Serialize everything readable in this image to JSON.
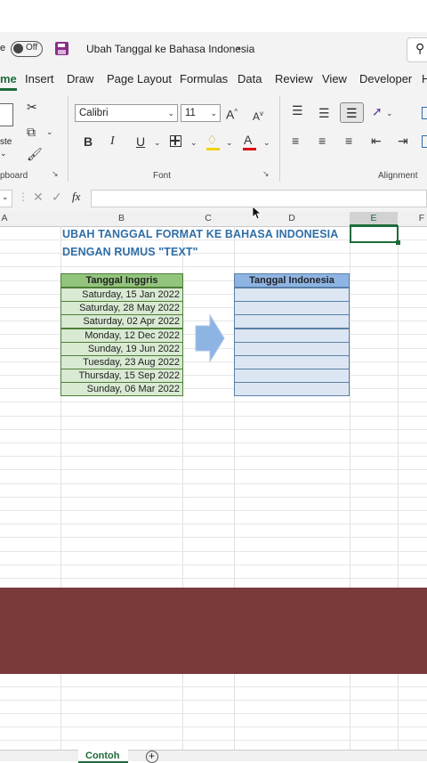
{
  "titlebar": {
    "autosave_suffix": "e",
    "autosave_state": "Off",
    "doc_title": "Ubah Tanggal ke Bahasa Indonesia",
    "search_glyph": "⚲"
  },
  "tabs": [
    "me",
    "Insert",
    "Draw",
    "Page Layout",
    "Formulas",
    "Data",
    "Review",
    "View",
    "Developer",
    "H"
  ],
  "ribbon": {
    "font_name": "Calibri",
    "font_size": "11",
    "paste_label": "ste",
    "clipboard_label": "pboard",
    "font_label": "Font",
    "alignment_label": "Alignment"
  },
  "formula_bar": {
    "fx": "fx",
    "value": ""
  },
  "columns": [
    "A",
    "B",
    "C",
    "D",
    "E",
    "F"
  ],
  "sheet": {
    "heading_line1": "UBAH TANGGAL FORMAT KE BAHASA INDONESIA",
    "heading_line2": "DENGAN RUMUS \"TEXT\"",
    "left_header": "Tanggal Inggris",
    "right_header": "Tanggal Indonesia",
    "dates": [
      "Saturday, 15 Jan 2022",
      "Saturday, 28 May 2022",
      "Saturday, 02 Apr 2022",
      "Monday, 12 Dec 2022",
      "Sunday, 19 Jun 2022",
      "Tuesday, 23 Aug 2022",
      "Thursday, 15 Sep 2022",
      "Sunday, 06 Mar 2022"
    ]
  },
  "sheet_tabs": {
    "active": "Contoh",
    "add": "+"
  },
  "colors": {
    "accent": "#1e6b3a",
    "left_header_bg": "#93c47d",
    "left_cell_bg": "#d9ead3",
    "right_header_bg": "#8eb4e3",
    "right_cell_bg": "#dce6f2",
    "arrow": "#8eb4e3",
    "banner": "#7a3a3a"
  }
}
